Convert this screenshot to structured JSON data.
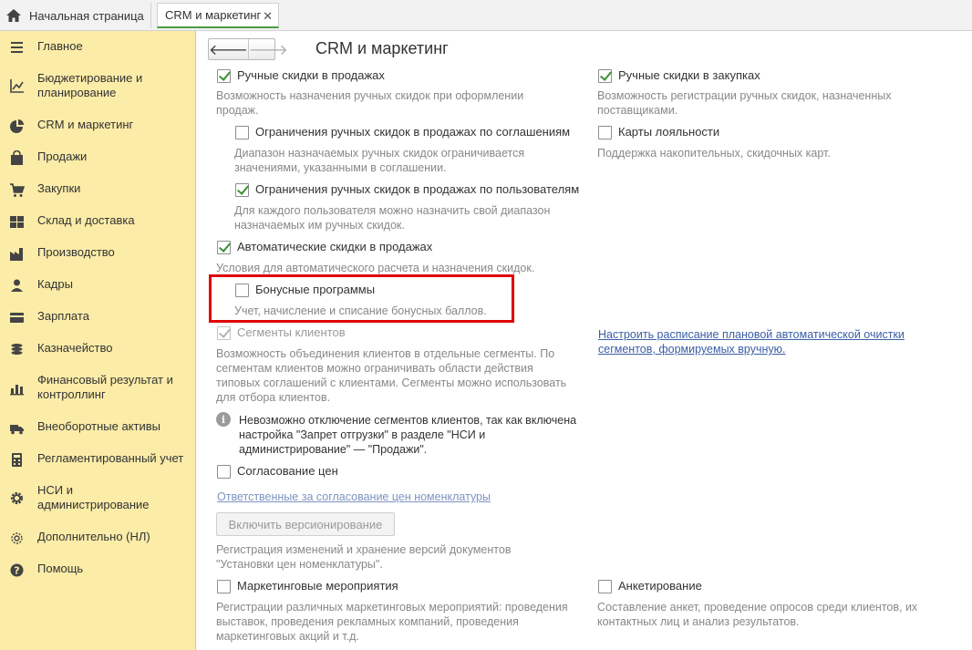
{
  "tabs": {
    "home": "Начальная страница",
    "active": "CRM и маркетинг",
    "close": "✕"
  },
  "sidebar": {
    "items": [
      {
        "label": "Главное",
        "icon": "menu-icon"
      },
      {
        "label": "Бюджетирование и планирование",
        "icon": "budget-icon"
      },
      {
        "label": "CRM и маркетинг",
        "icon": "pie-chart-icon"
      },
      {
        "label": "Продажи",
        "icon": "shopping-bag-icon"
      },
      {
        "label": "Закупки",
        "icon": "cart-icon"
      },
      {
        "label": "Склад и доставка",
        "icon": "warehouse-icon"
      },
      {
        "label": "Производство",
        "icon": "factory-icon"
      },
      {
        "label": "Кадры",
        "icon": "person-icon"
      },
      {
        "label": "Зарплата",
        "icon": "card-icon"
      },
      {
        "label": "Казначейство",
        "icon": "coins-icon"
      },
      {
        "label": "Финансовый результат и контроллинг",
        "icon": "bar-chart-icon"
      },
      {
        "label": "Внеоборотные активы",
        "icon": "truck-icon"
      },
      {
        "label": "Регламентированный учет",
        "icon": "calculator-icon"
      },
      {
        "label": "НСИ и администрирование",
        "icon": "gear-icon"
      },
      {
        "label": "Дополнительно (НЛ)",
        "icon": "settings-outline-icon"
      },
      {
        "label": "Помощь",
        "icon": "help-icon"
      }
    ]
  },
  "main": {
    "title": "CRM и маркетинг",
    "nav": {
      "back": "🡐",
      "forward": "🡒"
    },
    "options": {
      "manual_sales": {
        "label": "Ручные скидки в продажах",
        "desc": "Возможность назначения ручных скидок при оформлении продаж.",
        "checked": true
      },
      "limit_by_agreement": {
        "label": "Ограничения ручных скидок в продажах по соглашениям",
        "desc": "Диапазон назначаемых ручных скидок ограничивается значениями, указанными в соглашении.",
        "checked": false
      },
      "limit_by_user": {
        "label": "Ограничения ручных скидок в продажах по пользователям",
        "desc": "Для каждого пользователя можно назначить свой диапазон назначаемых им ручных скидок.",
        "checked": true
      },
      "auto_discounts": {
        "label": "Автоматические скидки в продажах",
        "desc": "Условия для автоматического расчета и назначения скидок.",
        "checked": true
      },
      "bonus_programs": {
        "label": "Бонусные программы",
        "desc": "Учет, начисление и списание бонусных баллов.",
        "checked": false
      },
      "client_segments": {
        "label": "Сегменты клиентов",
        "desc": "Возможность объединения клиентов в отдельные сегменты. По сегментам клиентов можно ограничивать области действия типовых соглашений с клиентами. Сегменты можно использовать для отбора клиентов.",
        "checked": true
      },
      "segments_info": "Невозможно отключение сегментов клиентов, так как включена настройка \"Запрет отгрузки\" в разделе \"НСИ и администрирование\" — \"Продажи\".",
      "price_approval": {
        "label": "Согласование цен",
        "checked": false
      },
      "price_approval_link": "Ответственные за согласование цен номенклатуры",
      "versioning_button": "Включить версионирование",
      "versioning_desc": "Регистрация изменений и хранение версий документов \"Установки цен номенклатуры\".",
      "marketing_events": {
        "label": "Маркетинговые мероприятия",
        "desc": "Регистрации различных маркетинговых мероприятий: проведения выставок, проведения рекламных компаний, проведения маркетинговых акций и т.д.",
        "checked": false
      },
      "manual_purchases": {
        "label": "Ручные скидки в закупках",
        "desc": "Возможность регистрации ручных скидок, назначенных поставщиками.",
        "checked": true
      },
      "loyalty_cards": {
        "label": "Карты лояльности",
        "desc": "Поддержка накопительных, скидочных карт.",
        "checked": false
      },
      "schedule_link": "Настроить расписание плановой автоматической очистки сегментов, формируемых вручную.",
      "questionnaire": {
        "label": "Анкетирование",
        "desc": "Составление анкет, проведение опросов среди клиентов, их контактных лиц и анализ результатов.",
        "checked": false
      }
    }
  },
  "colors": {
    "sidebar_bg": "#fbeca8",
    "highlight": "#e00000",
    "check": "#3a8f34",
    "link": "#3a5ea6"
  }
}
